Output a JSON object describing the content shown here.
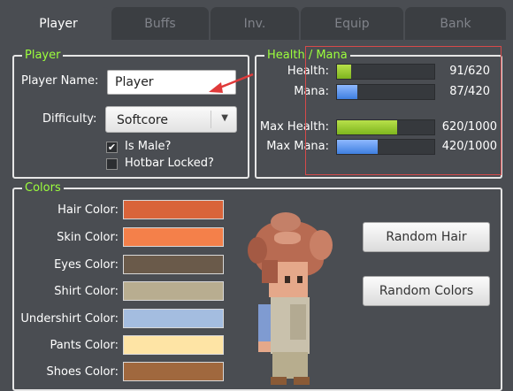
{
  "tabs": [
    {
      "label": "Player",
      "active": true
    },
    {
      "label": "Buffs",
      "active": false
    },
    {
      "label": "Inv.",
      "active": false
    },
    {
      "label": "Equip",
      "active": false
    },
    {
      "label": "Bank",
      "active": false
    }
  ],
  "player_group": {
    "legend": "Player",
    "name_label": "Player Name:",
    "name_value": "Player",
    "difficulty_label": "Difficulty:",
    "difficulty_value": "Softcore",
    "is_male_label": "Is Male?",
    "is_male_checked": true,
    "hotbar_label": "Hotbar Locked?",
    "hotbar_checked": false
  },
  "health_group": {
    "legend": "Health / Mana",
    "rows": [
      {
        "label": "Health:",
        "value": "91/620",
        "fraction": 0.147,
        "color": "#9ccd2d"
      },
      {
        "label": "Mana:",
        "value": "87/420",
        "fraction": 0.207,
        "color": "#5b93f0"
      },
      {
        "label": "Max Health:",
        "value": "620/1000",
        "fraction": 0.62,
        "color": "#9ccd2d"
      },
      {
        "label": "Max Mana:",
        "value": "420/1000",
        "fraction": 0.42,
        "color": "#5b93f0"
      }
    ]
  },
  "colors_group": {
    "legend": "Colors",
    "items": [
      {
        "label": "Hair Color:",
        "color": "#d9643a"
      },
      {
        "label": "Skin Color:",
        "color": "#f4804a"
      },
      {
        "label": "Eyes Color:",
        "color": "#6a5a4a"
      },
      {
        "label": "Shirt Color:",
        "color": "#b8ad90"
      },
      {
        "label": "Undershirt Color:",
        "color": "#a4bde0"
      },
      {
        "label": "Pants Color:",
        "color": "#fee4a5"
      },
      {
        "label": "Shoes Color:",
        "color": "#a0683e"
      }
    ],
    "random_hair_label": "Random Hair",
    "random_colors_label": "Random Colors"
  }
}
